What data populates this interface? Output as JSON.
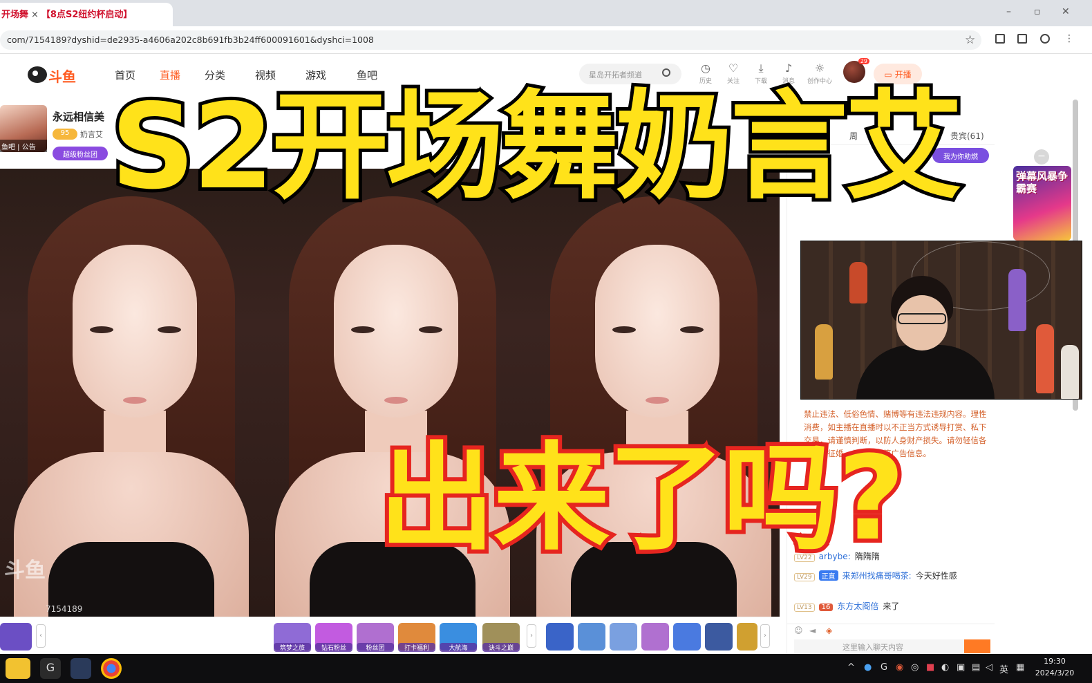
{
  "browser": {
    "tab_title": "开场舞",
    "tab_title_extra": "【8点S2纽约杯启动】",
    "tab_close": "×",
    "url": "com/7154189?dyshid=de2935-a4606a202c8b691fb3b24ff600091601&dyshci=1008",
    "win_min": "–",
    "win_max": "▫",
    "win_close": "✕"
  },
  "site": {
    "logo_text": "斗鱼",
    "nav": [
      "首页",
      "直播",
      "分类",
      "视频",
      "游戏",
      "鱼吧"
    ],
    "search_placeholder": "星岛开拓者频道",
    "header_icons": [
      {
        "icon": "clock-icon",
        "label": "历史"
      },
      {
        "icon": "heart-icon",
        "label": "关注"
      },
      {
        "icon": "download-icon",
        "label": "下载"
      },
      {
        "icon": "bell-icon",
        "label": "消息"
      },
      {
        "icon": "bulb-icon",
        "label": "创作中心"
      }
    ],
    "avatar_badge": "29",
    "start_button": "开播"
  },
  "room": {
    "title": "永远相信美",
    "level": "95",
    "anchor_name": "奶言艾",
    "fans_button": "超级粉丝团",
    "avatar_tags": [
      "鱼吧",
      "公告"
    ],
    "room_id": "7154189"
  },
  "overlay": {
    "headline": "S2开场舞奶言艾",
    "subline": "出来了吗?"
  },
  "gifts": [
    {
      "label": "筑梦之旅",
      "color": "#8f6bd6"
    },
    {
      "label": "钻石粉丝",
      "color": "#c25be0"
    },
    {
      "label": "粉丝团",
      "color": "#b06fd0"
    },
    {
      "label": "打卡福利",
      "color": "#e08a3c"
    },
    {
      "label": "大航海",
      "color": "#3a8ee0"
    },
    {
      "label": "诀斗之巅",
      "color": "#a0905a"
    }
  ],
  "chat": {
    "tab_labels": [
      "周",
      "贵宾(61)"
    ],
    "top_button": "我为你助燃",
    "notice": "禁止违法、低俗色情、赌博等有违法违规内容。理性消费，如主播在直播时以不正当方式诱导打赏、私下交易，请谨慎判断，以防人身财产损失。请勿轻信各类招聘征婚、代练代充等广告信息。",
    "messages": [
      {
        "level": "LV22",
        "user": "arbybe:",
        "text": "隋隋隋"
      },
      {
        "level": "LV29",
        "badge": "正直",
        "user": "来郑州找痛哥喝茶:",
        "text": "今天好性感"
      },
      {
        "level": "LV13",
        "badge": "16",
        "user": "东方太阁倍",
        "text": "来了"
      }
    ],
    "input_placeholder": "这里输入聊天内容"
  },
  "ad": {
    "title": "弹幕风暴争霸赛"
  },
  "taskbar": {
    "time": "19:30",
    "date": "2024/3/20",
    "lang": "英"
  }
}
